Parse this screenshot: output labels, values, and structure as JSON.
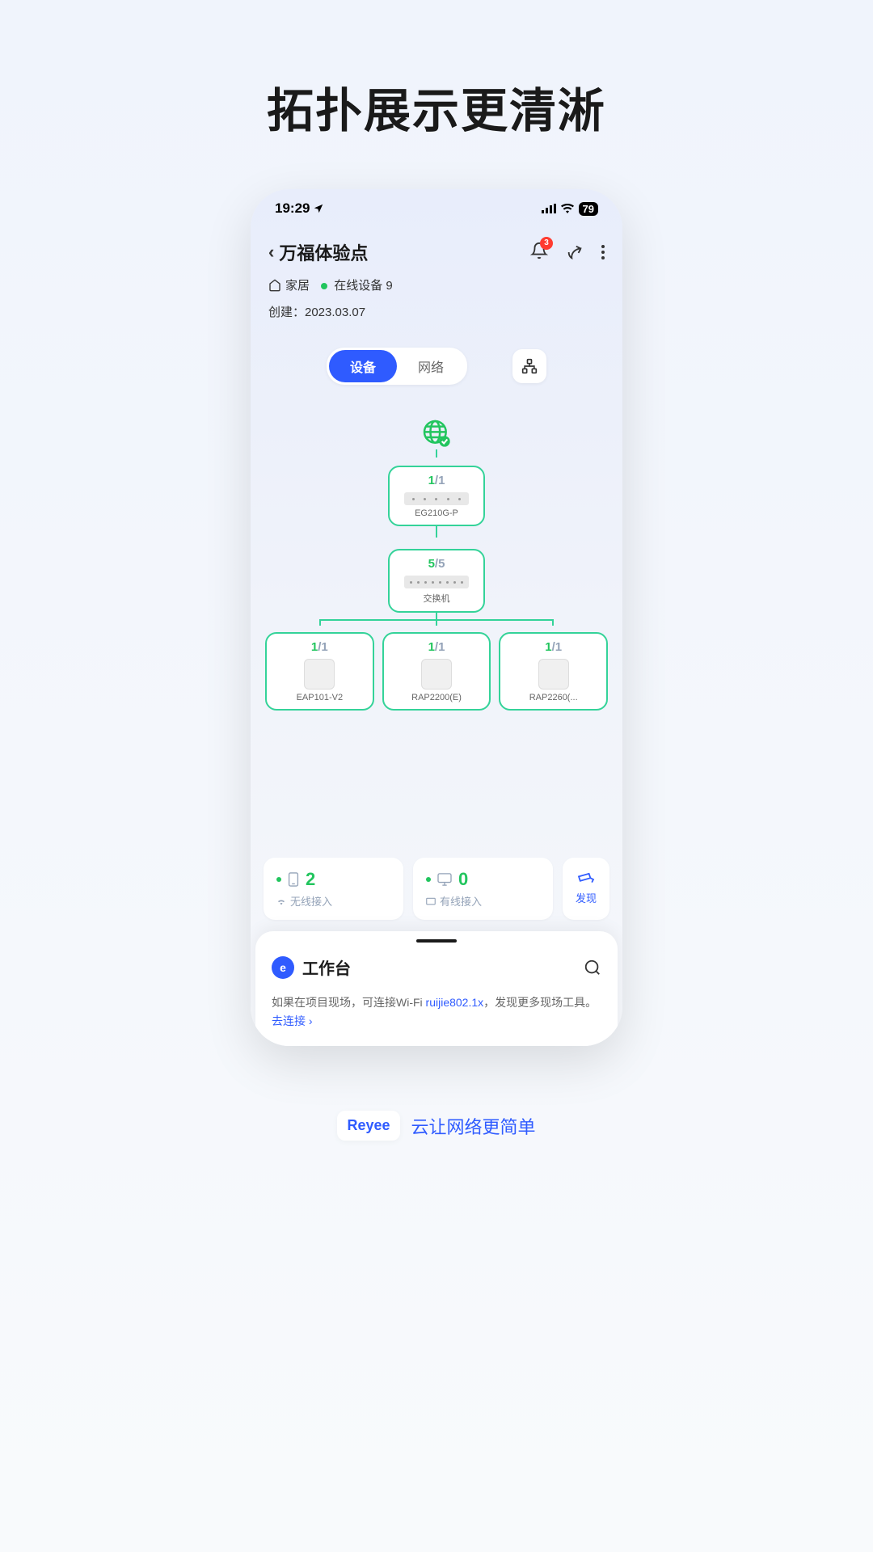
{
  "page_title": "拓扑展示更清淅",
  "status_bar": {
    "time": "19:29",
    "battery": "79"
  },
  "header": {
    "title": "万福体验点",
    "notification_count": "3",
    "home_tag": "家居",
    "online_devices_label": "在线设备 9",
    "created_label": "创建：2023.03.07"
  },
  "tabs": {
    "device": "设备",
    "network": "网络"
  },
  "topology": {
    "gateway": {
      "online": "1",
      "total": "/1",
      "label": "EG210G-P"
    },
    "switch": {
      "online": "5",
      "total": "/5",
      "label": "交换机"
    },
    "aps": [
      {
        "online": "1",
        "total": "/1",
        "label": "EAP101-V2"
      },
      {
        "online": "1",
        "total": "/1",
        "label": "RAP2200(E)"
      },
      {
        "online": "1",
        "total": "/1",
        "label": "RAP2260(..."
      }
    ]
  },
  "stats": {
    "wireless": {
      "count": "2",
      "label": "无线接入"
    },
    "wired": {
      "count": "0",
      "label": "有线接入"
    },
    "discover": "发现"
  },
  "sheet": {
    "title": "工作台",
    "tip_prefix": "如果在项目现场，可连接Wi-Fi ",
    "tip_wifi": "ruijie802.1x",
    "tip_suffix": "，发现更多现场工具。",
    "tip_link": "去连接 ›"
  },
  "footer": {
    "logo": "Reyee",
    "slogan": "云让网络更简单"
  }
}
